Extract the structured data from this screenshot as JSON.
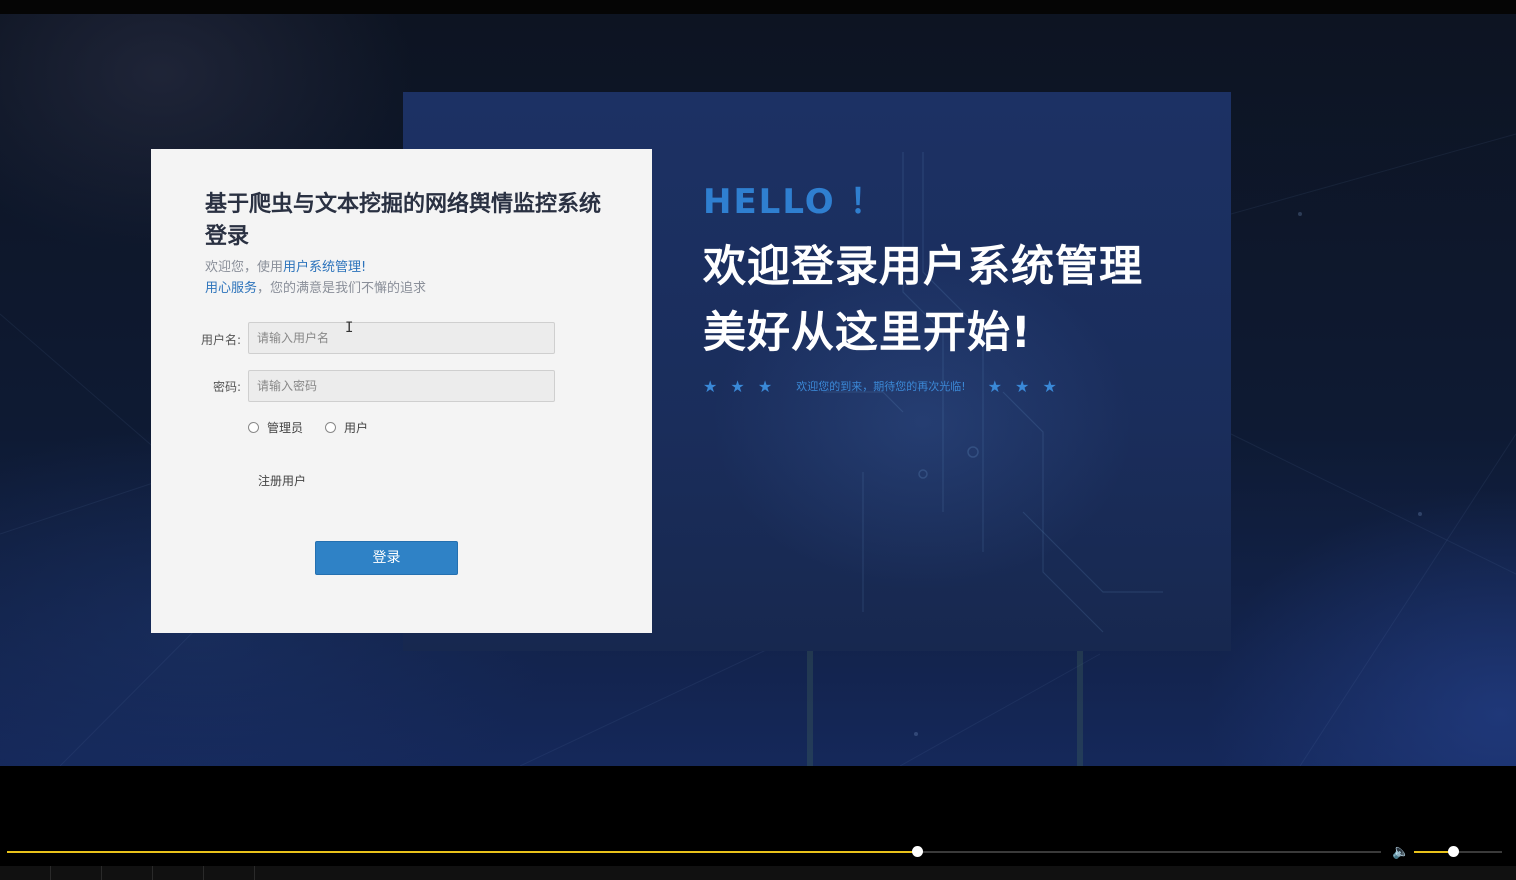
{
  "hero": {
    "hello": "HELLO ！",
    "line1": "欢迎登录用户系统管理",
    "line2": "美好从这里开始!",
    "stars_left": "★ ★ ★",
    "stars_text": "欢迎您的到来，期待您的再次光临!",
    "stars_right": "★ ★ ★"
  },
  "login": {
    "title": "基于爬虫与文本挖掘的网络舆情监控系统登录",
    "sub_prefix": "欢迎您，使用",
    "sub_highlight1": "用户系统管理!",
    "sub_highlight2": "用心服务",
    "sub_suffix": "，您的满意是我们不懈的追求",
    "username_label": "用户名:",
    "username_placeholder": "请输入用户名",
    "password_label": "密码:",
    "password_placeholder": "请输入密码",
    "role_admin": "管理员",
    "role_user": "用户",
    "register": "注册用户",
    "submit": "登录"
  },
  "player": {
    "progress": 0.662,
    "volume": 0.44
  },
  "colors": {
    "accent": "#2f82c6",
    "hello": "#2f7fd0",
    "progress": "#e8c21a"
  }
}
